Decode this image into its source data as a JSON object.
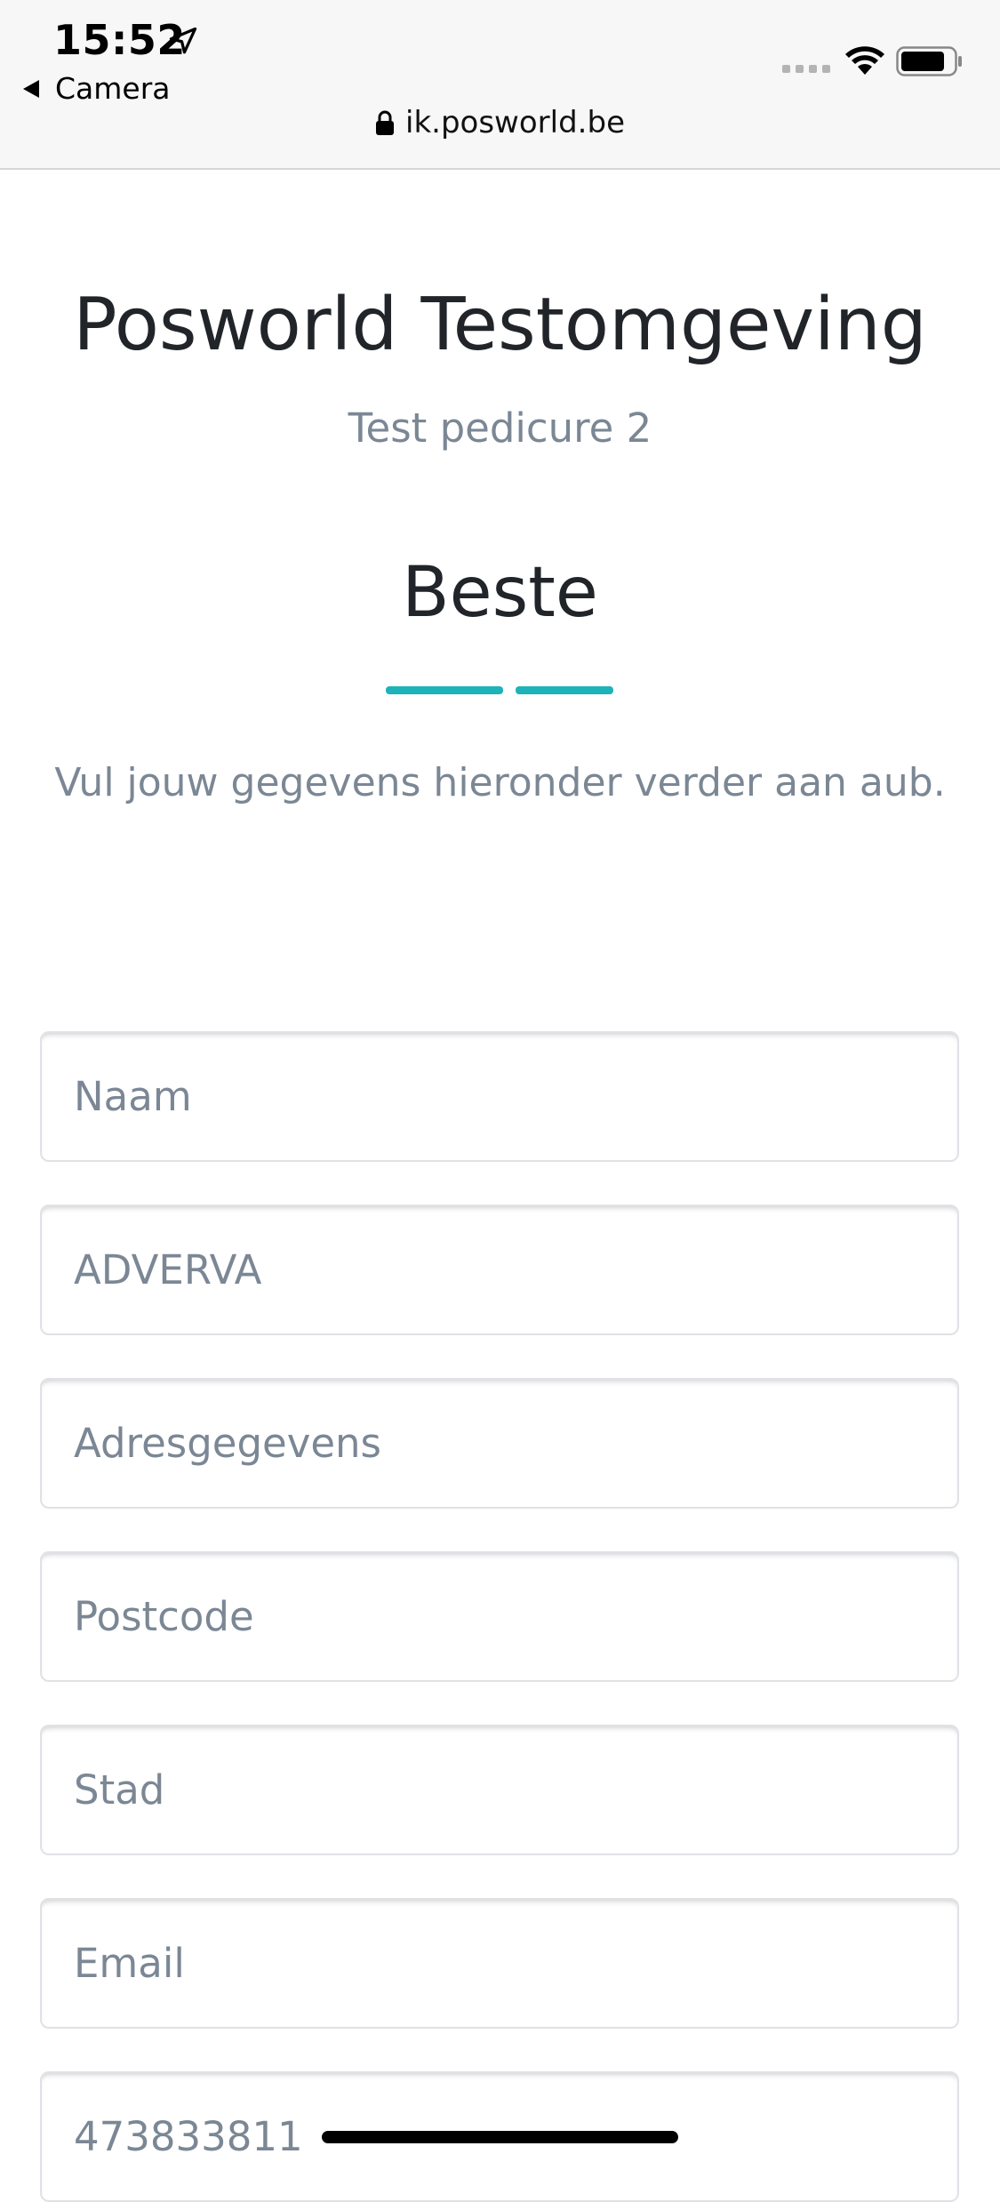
{
  "status_bar": {
    "time": "15:52",
    "back_label": "Camera",
    "url": "ik.posworld.be"
  },
  "header": {
    "title": "Posworld Testomgeving",
    "subtitle": "Test pedicure 2",
    "greeting": "Beste",
    "instruction": "Vul jouw gegevens hieronder verder aan aub.",
    "accent_color": "#1eb3b8"
  },
  "form": {
    "name_placeholder": "Naam",
    "company_value": "ADVERVA",
    "address_placeholder": "Adresgegevens",
    "postcode_placeholder": "Postcode",
    "city_placeholder": "Stad",
    "email_placeholder": "Email",
    "phone_value": "473833811"
  },
  "icons": {
    "location": "location-arrow-icon",
    "wifi": "wifi-icon",
    "battery": "battery-icon",
    "lock": "lock-icon"
  }
}
